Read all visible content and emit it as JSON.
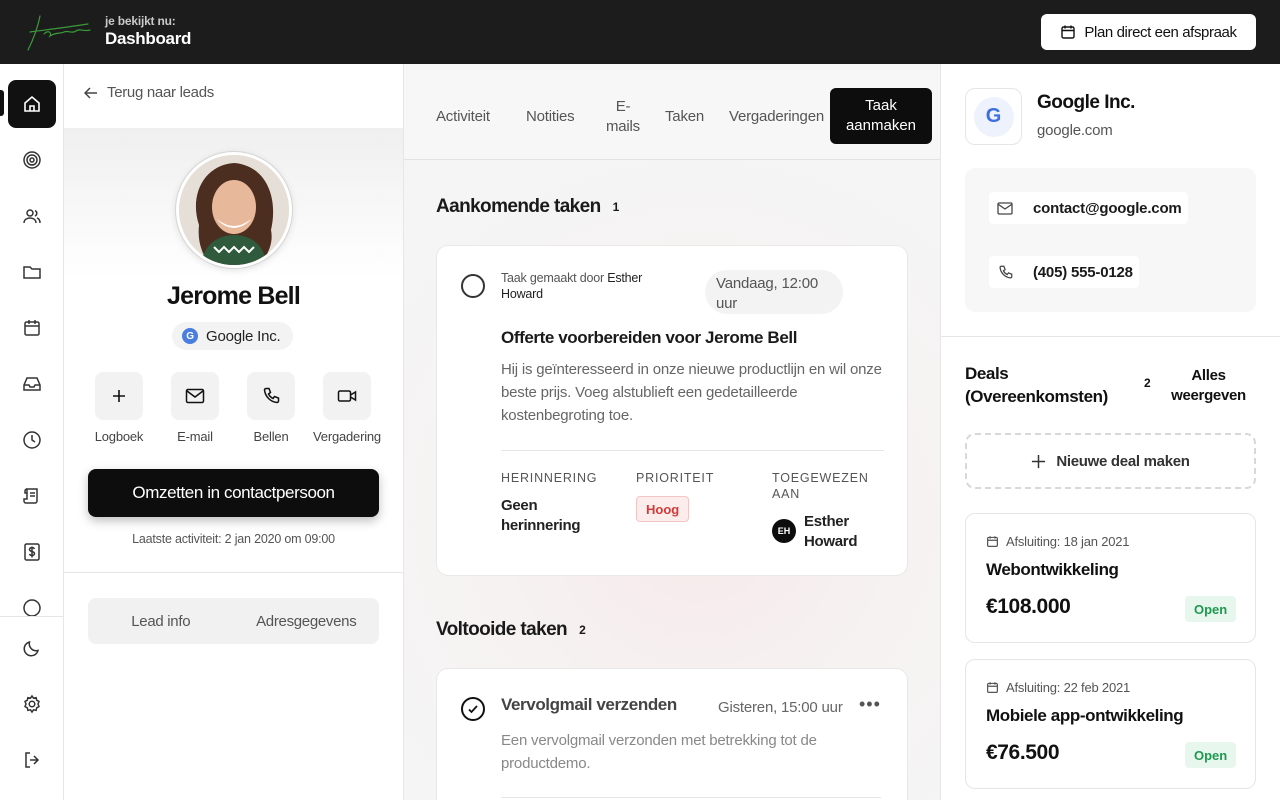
{
  "header": {
    "logo_text": "Jason",
    "viewing_label": "je bekijkt nu:",
    "viewing_page": "Dashboard",
    "plan_button": "Plan direct een afspraak"
  },
  "nav": {
    "items": [
      "home",
      "target",
      "users",
      "folder",
      "calendar",
      "inbox",
      "clock",
      "scroll",
      "dollar",
      "more"
    ],
    "bottom": [
      "moon",
      "settings",
      "logout"
    ]
  },
  "lead": {
    "back_label": "Terug naar leads",
    "name": "Jerome Bell",
    "company": "Google Inc.",
    "company_initial": "G",
    "actions": [
      {
        "icon": "plus-icon",
        "label": "Logboek"
      },
      {
        "icon": "mail-icon",
        "label": "E-mail"
      },
      {
        "icon": "phone-icon",
        "label": "Bellen"
      },
      {
        "icon": "video-icon",
        "label": "Vergadering"
      }
    ],
    "convert_button": "Omzetten in contactpersoon",
    "last_activity": "Laatste activiteit: 2 jan 2020 om 09:00",
    "tabs": [
      "Lead info",
      "Adresgegevens"
    ]
  },
  "tabs": {
    "activity": "Activiteit",
    "notes": "Notities",
    "emails_line1": "E-",
    "emails_line2": "mails",
    "tasks": "Taken",
    "meetings": "Vergaderingen",
    "create_task_line1": "Taak",
    "create_task_line2": "aanmaken"
  },
  "upcoming": {
    "title": "Aankomende taken",
    "count": "1",
    "task": {
      "made_by_prefix": "Taak gemaakt door",
      "made_by_name": "Esther Howard",
      "date": "Vandaag, 12:00 uur",
      "title": "Offerte voorbereiden voor Jerome Bell",
      "description": "Hij is geïnteresseerd in onze nieuwe productlijn en wil onze beste prijs. Voeg alstublieft een gedetailleerde kostenbegroting toe.",
      "reminder_label": "HERINNERING",
      "reminder_line1": "Geen",
      "reminder_line2": "herinnering",
      "priority_label": "PRIORITEIT",
      "priority": "Hoog",
      "assigned_label_line1": "TOEGEWEZEN",
      "assigned_label_line2": "AAN",
      "assignee_initials": "EH",
      "assignee_line1": "Esther",
      "assignee_line2": "Howard"
    }
  },
  "completed": {
    "title": "Voltooide taken",
    "count": "2",
    "task": {
      "title": "Vervolgmail verzenden",
      "date": "Gisteren, 15:00 uur",
      "description": "Een vervolgmail verzonden met betrekking tot de productdemo."
    }
  },
  "company": {
    "initial": "G",
    "name": "Google Inc.",
    "domain": "google.com",
    "email": "contact@google.com",
    "phone": "(405) 555-0128"
  },
  "deals": {
    "title": "Deals (Overeenkomsten)",
    "count": "2",
    "view_all_line1": "Alles",
    "view_all_line2": "weergeven",
    "new_deal": "Nieuwe deal maken",
    "items": [
      {
        "closing": "Afsluiting: 18 jan 2021",
        "name": "Webontwikkeling",
        "amount": "€108.000",
        "status": "Open"
      },
      {
        "closing": "Afsluiting: 22 feb 2021",
        "name": "Mobiele app-ontwikkeling",
        "amount": "€76.500",
        "status": "Open"
      }
    ]
  }
}
